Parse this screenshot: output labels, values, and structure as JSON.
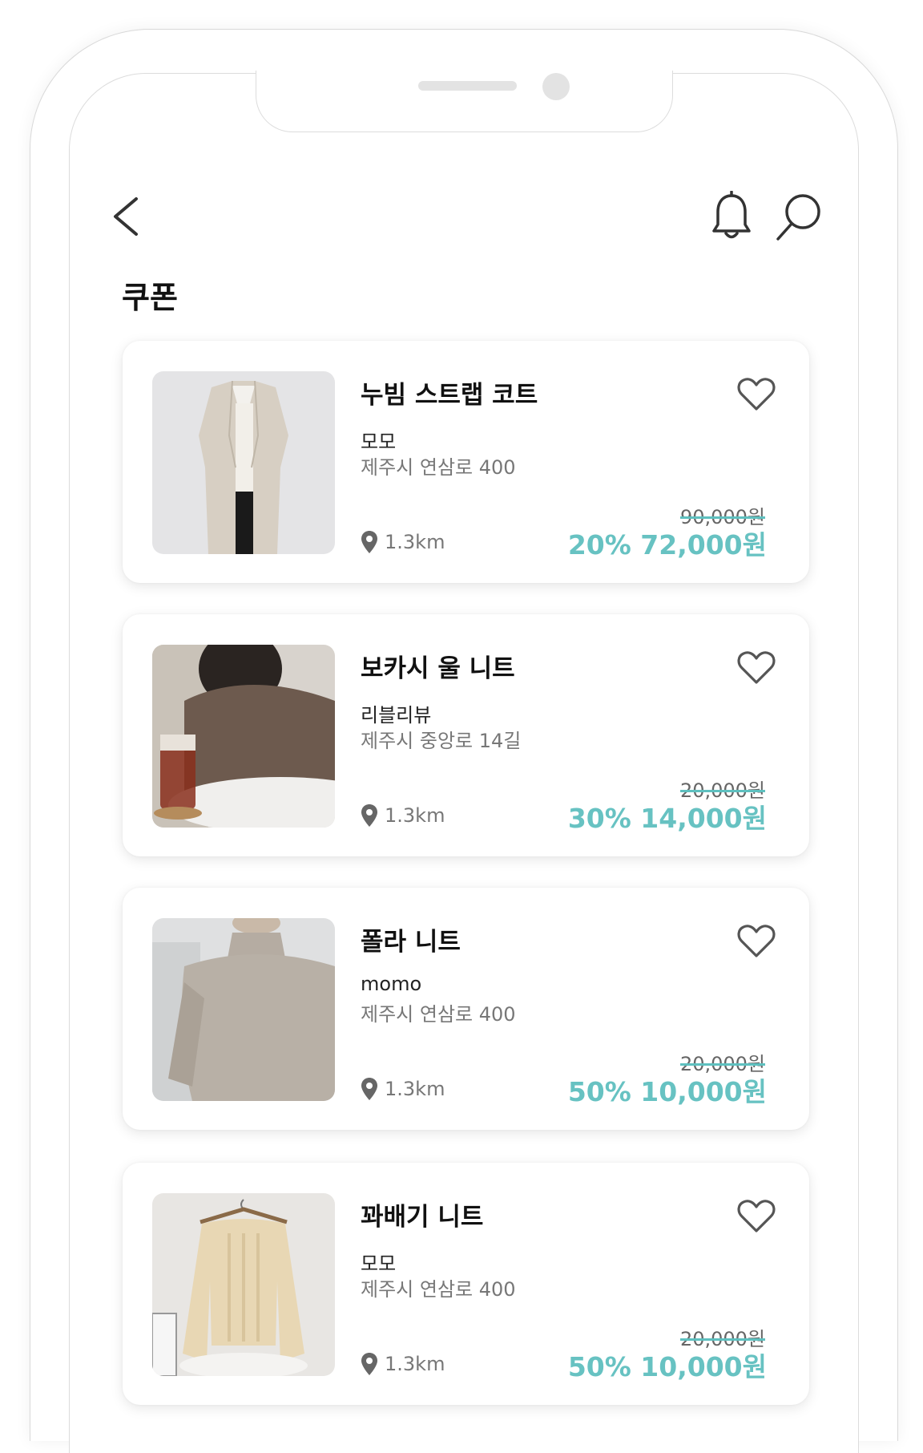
{
  "header": {
    "back_icon": "chevron-left-icon",
    "bell_icon": "bell-icon",
    "search_icon": "search-icon",
    "title": "쿠폰"
  },
  "colors": {
    "accent": "#67c2c2",
    "strike": "#5ec0bf",
    "icon": "#333333"
  },
  "coupons": [
    {
      "name": "누빔 스트랩 코트",
      "store": "모모",
      "address": "제주시 연삼로 400",
      "distance": "1.3km",
      "original_price": "90,000원",
      "sale_price": "20% 72,000원",
      "image": "beige-long-coat",
      "favorite_icon": "heart-icon"
    },
    {
      "name": "보카시 울 니트",
      "store": "리블리뷰",
      "address": "제주시 중앙로 14길",
      "distance": "1.3km",
      "original_price": "20,000원",
      "sale_price": "30% 14,000원",
      "image": "brown-wool-knit",
      "favorite_icon": "heart-icon"
    },
    {
      "name": "폴라 니트",
      "store": "momo",
      "address": "제주시 연삼로 400",
      "distance": "1.3km",
      "original_price": "20,000원",
      "sale_price": "50% 10,000원",
      "image": "grey-turtleneck-knit",
      "favorite_icon": "heart-icon"
    },
    {
      "name": "꽈배기 니트",
      "store": "모모",
      "address": "제주시 연삼로 400",
      "distance": "1.3km",
      "original_price": "20,000원",
      "sale_price": "50% 10,000원",
      "image": "cream-cable-knit",
      "favorite_icon": "heart-icon"
    }
  ]
}
